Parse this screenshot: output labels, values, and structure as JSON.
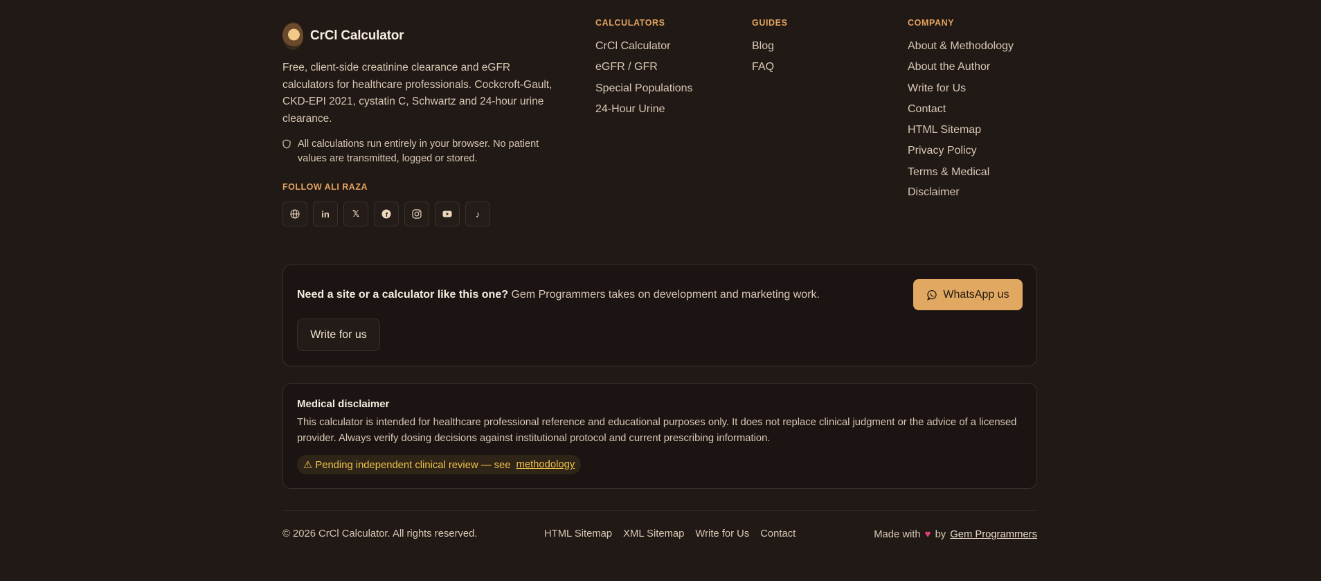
{
  "brand": {
    "name": "CrCl Calculator",
    "tagline": "Free, client-side creatinine clearance and eGFR calculators for healthcare professionals. Cockcroft-Gault, CKD-EPI 2021, cystatin C, Schwartz and 24-hour urine clearance.",
    "privacy_note": "All calculations run entirely in your browser. No patient values are transmitted, logged or stored.",
    "follow_title": "FOLLOW ALI RAZA",
    "socials": [
      "globe-icon",
      "linkedin-icon",
      "x-icon",
      "facebook-icon",
      "instagram-icon",
      "youtube-icon",
      "tiktok-icon"
    ]
  },
  "columns": {
    "calculators": {
      "title": "CALCULATORS",
      "links": [
        "CrCl Calculator",
        "eGFR / GFR",
        "Special Populations",
        "24-Hour Urine"
      ]
    },
    "guides": {
      "title": "GUIDES",
      "links": [
        "Blog",
        "FAQ"
      ]
    },
    "company": {
      "title": "COMPANY",
      "links": [
        "About & Methodology",
        "About the Author",
        "Write for Us",
        "Contact",
        "HTML Sitemap",
        "Privacy Policy",
        "Terms & Medical Disclaimer"
      ]
    }
  },
  "cta": {
    "bold": "Need a site or a calculator like this one?",
    "text": " Gem Programmers takes on development and marketing work.",
    "whatsapp_label": "WhatsApp us",
    "write_label": "Write for us"
  },
  "disclaimer": {
    "title": "Medical disclaimer",
    "body": "This calculator is intended for healthcare professional reference and educational purposes only. It does not replace clinical judgment or the advice of a licensed provider. Always verify dosing decisions against institutional protocol and current prescribing information.",
    "pending_text": "⚠ Pending independent clinical review — see",
    "pending_link": "methodology"
  },
  "footer": {
    "copyright": "© 2026 CrCl Calculator. All rights reserved.",
    "links": [
      "HTML Sitemap",
      "XML Sitemap",
      "Write for Us",
      "Contact"
    ],
    "made_with": "Made with",
    "by": "by",
    "author_link": "Gem Programmers"
  },
  "colors": {
    "background": "#201915",
    "accent": "#e1a862",
    "warning": "#f0c34a",
    "heart": "#e8407a"
  }
}
